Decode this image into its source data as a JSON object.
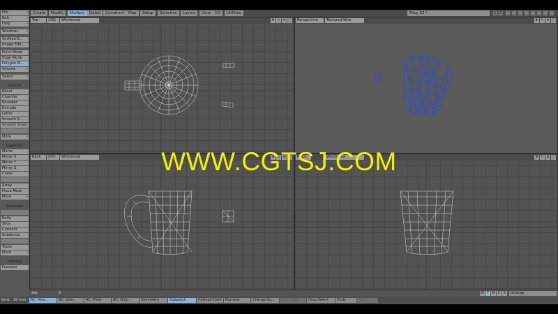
{
  "menu_tabs": [
    "Create",
    "Modify",
    "Multiply",
    "Detail",
    "Construct",
    "Map",
    "Setup",
    "Selection",
    "Layers",
    "View",
    "I/O",
    "Utilities"
  ],
  "active_tab": "Multiply",
  "file_title": "Mug_03 *",
  "top_icons": [
    "1",
    "2"
  ],
  "toolbar": {
    "file": "File",
    "edit": "Edit",
    "help": "Help",
    "windows": "Windows",
    "surface_editor": "Surface E...",
    "image_editor": "Image Edit...",
    "point_mode": "Point Mode",
    "edge_mode": "Edge Mode",
    "polygon_mode": "Polygon M...",
    "volume": "Volume",
    "select": "Select",
    "extend_header": "Extend",
    "bevel": "Bevel",
    "chamfer": "Chamfer",
    "rounder": "Rounder",
    "extrude": "Extrude",
    "lathe": "Lathe",
    "smooth_shift": "Smooth S...",
    "smooth_scale": "Smooth Scale",
    "more1": "More",
    "duplicate_header": "Duplicate",
    "mirror": "Mirror",
    "mirror_x": "Mirror X",
    "mirror_y": "Mirror Y",
    "mirror_z": "Mirror Z",
    "clone": "Clone",
    "array": "Array",
    "place_mesh": "Place Mesh",
    "more2": "More",
    "subdivide_header": "Subdivide",
    "knife": "Knife",
    "slice": "Slice",
    "connect": "Connect",
    "subdivide": "Subdivide",
    "triple": "Triple",
    "more3": "More",
    "destroy_header": "Destroy",
    "fracture": "Fracture"
  },
  "viewports": {
    "top": {
      "view": "Top",
      "axis": "(XZ)",
      "mode": "Wireframe"
    },
    "perspective": {
      "view": "Perspective",
      "mode": "Textured Wire"
    },
    "back": {
      "view": "Back",
      "axis": "(XY)",
      "mode": "Wireframe"
    },
    "right": {
      "view": "Right",
      "mode": "Wireframe"
    }
  },
  "watermark": "WWW.CGTSJ.COM",
  "setbar": {
    "label": "Set",
    "value": "0",
    "wtmcs": [
      "W",
      "T",
      "M",
      "C",
      "S"
    ],
    "unwrap": "Unwrap"
  },
  "statusbar": {
    "grid_label": "Grid:",
    "grid_value": "20 mm",
    "items": [
      "AC: Mou...",
      "AC: Sele...",
      "AC: Pivot",
      "AC: Orig...",
      "Symmetry",
      "Subpatch",
      "Catmull-Clark",
      "Numeric",
      "Change Su...",
      "Drop Tool",
      "Drop Select",
      "Undo",
      "Redo"
    ]
  },
  "colors": {
    "active_blue": "#8fb3d8",
    "mesh_blue": "#2a4fd6",
    "watermark": "#f5f000"
  }
}
